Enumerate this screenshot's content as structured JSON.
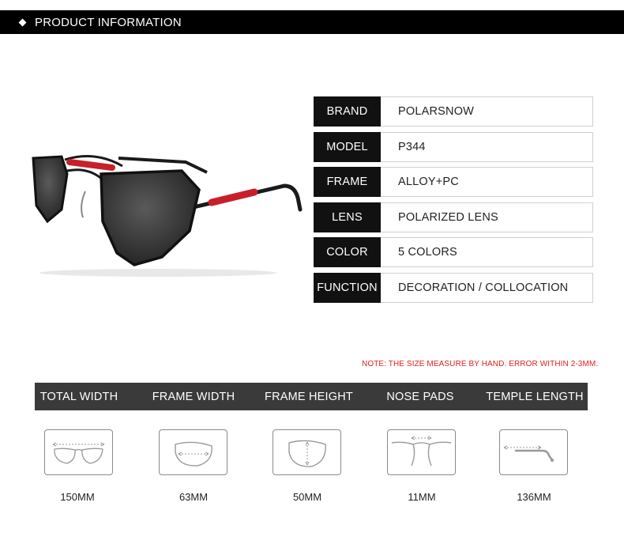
{
  "header": {
    "title": "PRODUCT INFORMATION",
    "icon": "diamond-icon"
  },
  "specs": [
    {
      "key": "BRAND",
      "value": "POLARSNOW"
    },
    {
      "key": "MODEL",
      "value": "P344"
    },
    {
      "key": "FRAME",
      "value": "ALLOY+PC"
    },
    {
      "key": "LENS",
      "value": "POLARIZED LENS"
    },
    {
      "key": "COLOR",
      "value": "5 COLORS"
    },
    {
      "key": "FUNCTION",
      "value": "DECORATION / COLLOCATION"
    }
  ],
  "note": "NOTE: THE SIZE MEASURE BY HAND. ERROR WITHIN 2-3MM.",
  "measurements": [
    {
      "label": "TOTAL WIDTH",
      "value": "150MM",
      "icon": "total-width-icon"
    },
    {
      "label": "FRAME WIDTH",
      "value": "63MM",
      "icon": "frame-width-icon"
    },
    {
      "label": "FRAME HEIGHT",
      "value": "50MM",
      "icon": "frame-height-icon"
    },
    {
      "label": "NOSE PADS",
      "value": "11MM",
      "icon": "nose-pads-icon"
    },
    {
      "label": "TEMPLE LENGTH",
      "value": "136MM",
      "icon": "temple-length-icon"
    }
  ],
  "colors": {
    "header_bg": "#000000",
    "spec_key_bg": "#111111",
    "measure_bar_bg": "#3a3a3a",
    "note_text": "#e02020",
    "temple_accent": "#c8202a"
  }
}
